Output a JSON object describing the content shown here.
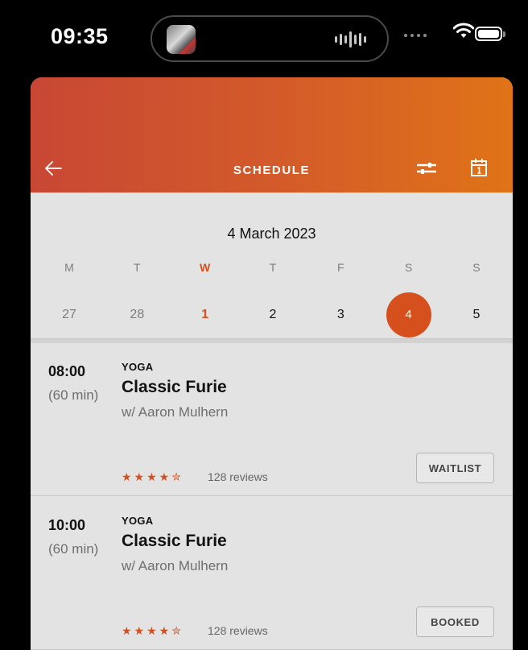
{
  "status_bar": {
    "time": "09:35"
  },
  "header": {
    "title": "SCHEDULE",
    "icons": [
      "back-arrow-icon",
      "filter-icon",
      "calendar-icon"
    ],
    "gradient_colors": [
      "#c84734",
      "#e07317"
    ]
  },
  "calendar": {
    "month_label": "4 March 2023",
    "days": [
      {
        "name": "M",
        "date": "27",
        "state": "past"
      },
      {
        "name": "T",
        "date": "28",
        "state": "past"
      },
      {
        "name": "W",
        "date": "1",
        "state": "current"
      },
      {
        "name": "T",
        "date": "2",
        "state": "normal"
      },
      {
        "name": "F",
        "date": "3",
        "state": "normal"
      },
      {
        "name": "S",
        "date": "4",
        "state": "selected"
      },
      {
        "name": "S",
        "date": "5",
        "state": "normal"
      }
    ],
    "accent_color": "#d5501d"
  },
  "classes": [
    {
      "time": "08:00",
      "duration": "(60 min)",
      "category": "YOGA",
      "name": "Classic Furie",
      "instructor": "w/ Aaron Mulhern",
      "rating": 4.5,
      "reviews": "128 reviews",
      "action": "WAITLIST"
    },
    {
      "time": "10:00",
      "duration": "(60 min)",
      "category": "YOGA",
      "name": "Classic Furie",
      "instructor": "w/ Aaron Mulhern",
      "rating": 4.5,
      "reviews": "128 reviews",
      "action": "BOOKED"
    }
  ]
}
